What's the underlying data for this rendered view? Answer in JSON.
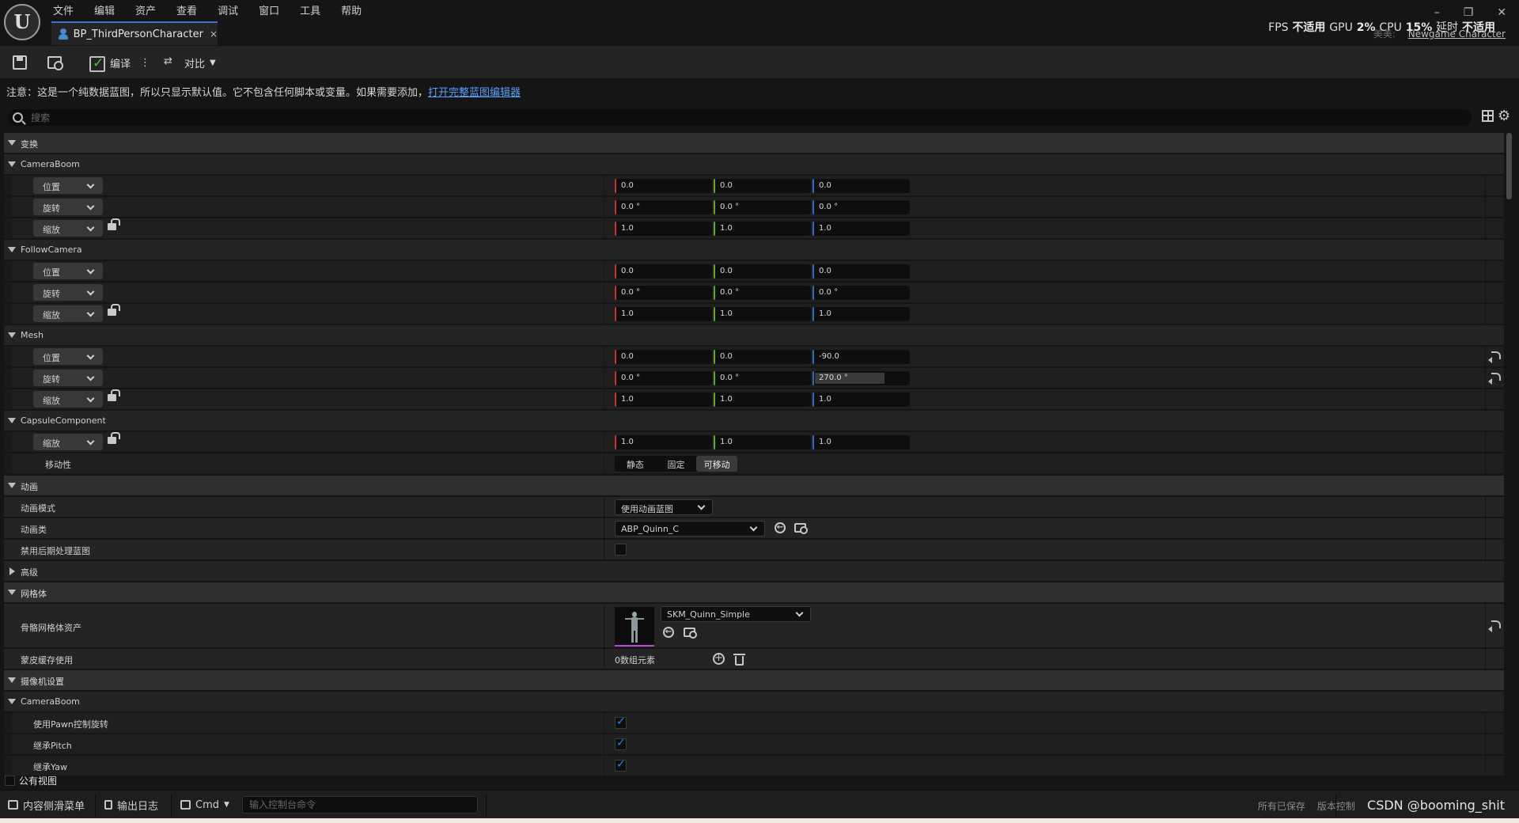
{
  "menu": [
    "文件",
    "编辑",
    "资产",
    "查看",
    "调试",
    "窗口",
    "工具",
    "帮助"
  ],
  "tab": {
    "title": "BP_ThirdPersonCharacter",
    "close": "×"
  },
  "window_controls": [
    "–",
    "❐",
    "✕"
  ],
  "stats": {
    "fps_label": "FPS",
    "fps_value": "不适用",
    "gpu_label": "GPU",
    "gpu_value": "2%",
    "cpu_label": "CPU",
    "cpu_value": "15%",
    "latency_label": "延时",
    "latency_value": "不适用"
  },
  "user": {
    "ghost": "美美:",
    "name": "Newgame Character"
  },
  "toolbar": {
    "compile_label": "编译",
    "more": "⋮",
    "diff_label": "对比"
  },
  "notice": {
    "text": "注意：这是一个纯数据蓝图，所以只显示默认值。它不包含任何脚本或变量。如果需要添加，",
    "link": "打开完整蓝图编辑器"
  },
  "search": {
    "placeholder": "搜索"
  },
  "labels": {
    "location": "位置",
    "rotation": "旋转",
    "scale": "缩放",
    "transform": "变换",
    "camera_boom": "CameraBoom",
    "follow_camera": "FollowCamera",
    "mesh": "Mesh",
    "capsule": "CapsuleComponent",
    "mobility": "移动性",
    "animation": "动画",
    "anim_mode": "动画模式",
    "anim_class": "动画类",
    "disable_post_process": "禁用后期处理蓝图",
    "advanced": "高级",
    "mesh_cat": "网格体",
    "skeletal_mesh_asset": "骨骼网格体资产",
    "skin_cache_usage": "蒙皮缓存使用",
    "camera_settings": "摄像机设置",
    "camera_boom2": "CameraBoom",
    "use_pawn_control_rotation": "使用Pawn控制旋转",
    "inherit_pitch": "继承Pitch",
    "inherit_yaw": "继承Yaw"
  },
  "values": {
    "zero": "0.0",
    "zero_deg": "0.0 °",
    "one": "1.0",
    "mesh_loc_z": "-90.0",
    "mesh_rot_z": "270.0 °"
  },
  "mobility": {
    "static": "静态",
    "stationary": "固定",
    "movable": "可移动",
    "selected": "可移动"
  },
  "anim": {
    "mode": "使用动画蓝图",
    "class": "ABP_Quinn_C"
  },
  "mesh_asset": "SKM_Quinn_Simple",
  "skin_cache": "0数组元素",
  "checks": {
    "disable_post_process": false,
    "use_pawn_control_rotation": true,
    "inherit_pitch": true,
    "inherit_yaw": true
  },
  "public_view": "公有视图",
  "statusbar": {
    "content_drawer": "内容侧滑菜单",
    "output_log": "输出日志",
    "cmd": "Cmd",
    "console_placeholder": "输入控制台命令",
    "ghost_right": "所有已保存",
    "source_control": "版本控制"
  },
  "watermark": "CSDN @booming_shit",
  "colors": {
    "accent": "#3b6fd0",
    "x_axis": "#c2352e",
    "y_axis": "#5fa82c",
    "z_axis": "#2b69c9",
    "check": "#2f7ff0"
  }
}
